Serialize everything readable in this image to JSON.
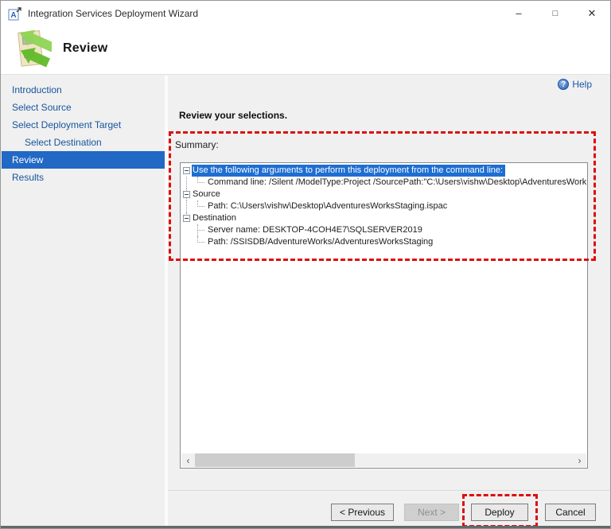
{
  "window": {
    "title": "Integration Services Deployment Wizard",
    "controls": {
      "minimize": "–",
      "maximize": "□",
      "close": "✕"
    }
  },
  "header": {
    "title": "Review"
  },
  "sidebar": {
    "items": [
      {
        "label": "Introduction",
        "indent": false,
        "selected": false
      },
      {
        "label": "Select Source",
        "indent": false,
        "selected": false
      },
      {
        "label": "Select Deployment Target",
        "indent": false,
        "selected": false
      },
      {
        "label": "Select Destination",
        "indent": true,
        "selected": false
      },
      {
        "label": "Review",
        "indent": false,
        "selected": true
      },
      {
        "label": "Results",
        "indent": false,
        "selected": false
      }
    ]
  },
  "content": {
    "help_label": "Help",
    "help_icon_glyph": "?",
    "heading": "Review your selections.",
    "summary_label": "Summary:",
    "tree": [
      {
        "label": "Use the following arguments to perform this deployment from the command line:",
        "level": 0,
        "expander": true,
        "selected": true,
        "rootline": "none"
      },
      {
        "label": "Command line: /Silent /ModelType:Project /SourcePath:\"C:\\Users\\vishw\\Desktop\\AdventuresWorks",
        "level": 1,
        "last": true,
        "rootline": "full"
      },
      {
        "label": "Source",
        "level": 0,
        "expander": true,
        "rootline": "full"
      },
      {
        "label": "Path: C:\\Users\\vishw\\Desktop\\AdventuresWorksStaging.ispac",
        "level": 1,
        "last": true,
        "rootline": "full"
      },
      {
        "label": "Destination",
        "level": 0,
        "expander": true,
        "rootline": "half"
      },
      {
        "label": "Server name: DESKTOP-4COH4E7\\SQLSERVER2019",
        "level": 1,
        "last": false,
        "rootline": "none"
      },
      {
        "label": "Path: /SSISDB/AdventureWorks/AdventuresWorksStaging",
        "level": 1,
        "last": true,
        "rootline": "none"
      }
    ],
    "scrollbar": {
      "left_arrow": "‹",
      "right_arrow": "›"
    }
  },
  "footer": {
    "previous_label": "< Previous",
    "next_label": "Next >",
    "deploy_label": "Deploy",
    "cancel_label": "Cancel"
  },
  "colors": {
    "nav_selected_blue": "#2268c5",
    "tree_selection_blue": "#1e6ed2",
    "annotation_red": "#dd0e0e",
    "link_blue": "#16549d"
  }
}
